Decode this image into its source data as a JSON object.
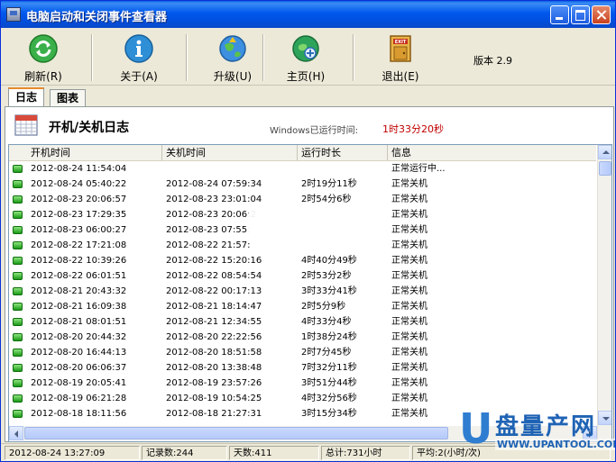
{
  "window": {
    "title": "电脑启动和关闭事件查看器"
  },
  "toolbar": {
    "refresh_label": "刷新(R)",
    "about_label": "关于(A)",
    "upgrade_label": "升级(U)",
    "home_label": "主页(H)",
    "exit_label": "退出(E)",
    "exit_badge": "EXIT",
    "version": "版本 2.9"
  },
  "tabs": [
    {
      "label": "日志",
      "active": true
    },
    {
      "label": "图表",
      "active": false
    }
  ],
  "panel": {
    "title": "开机/关机日志",
    "uptime_label": "Windows已运行时间:",
    "uptime_value": "1时33分20秒"
  },
  "columns": [
    "开机时间",
    "关机时间",
    "运行时长",
    "信息"
  ],
  "rows": [
    {
      "boot": "2012-08-24 11:54:04",
      "shutdown": "",
      "duration": "",
      "info": "正常运行中..."
    },
    {
      "boot": "2012-08-24 05:40:22",
      "shutdown": "2012-08-24 07:59:34",
      "duration": "2时19分11秒",
      "info": "正常关机"
    },
    {
      "boot": "2012-08-23 20:06:57",
      "shutdown": "2012-08-23 23:01:04",
      "duration": "2时54分6秒",
      "info": "正常关机"
    },
    {
      "boot": "2012-08-23 17:29:35",
      "shutdown": "2012-08-23 20:06:2",
      "duration": "",
      "info": "正常关机"
    },
    {
      "boot": "2012-08-23 06:00:27",
      "shutdown": "2012-08-23 07:55:",
      "duration": "",
      "info": "正常关机"
    },
    {
      "boot": "2012-08-22 17:21:08",
      "shutdown": "2012-08-22 21:57:",
      "duration": "",
      "info": "正常关机"
    },
    {
      "boot": "2012-08-22 10:39:26",
      "shutdown": "2012-08-22 15:20:16",
      "duration": "4时40分49秒",
      "info": "正常关机"
    },
    {
      "boot": "2012-08-22 06:01:51",
      "shutdown": "2012-08-22 08:54:54",
      "duration": "2时53分2秒",
      "info": "正常关机"
    },
    {
      "boot": "2012-08-21 20:43:32",
      "shutdown": "2012-08-22 00:17:13",
      "duration": "3时33分41秒",
      "info": "正常关机"
    },
    {
      "boot": "2012-08-21 16:09:38",
      "shutdown": "2012-08-21 18:14:47",
      "duration": "2时5分9秒",
      "info": "正常关机"
    },
    {
      "boot": "2012-08-21 08:01:51",
      "shutdown": "2012-08-21 12:34:55",
      "duration": "4时33分4秒",
      "info": "正常关机"
    },
    {
      "boot": "2012-08-20 20:44:32",
      "shutdown": "2012-08-20 22:22:56",
      "duration": "1时38分24秒",
      "info": "正常关机"
    },
    {
      "boot": "2012-08-20 16:44:13",
      "shutdown": "2012-08-20 18:51:58",
      "duration": "2时7分45秒",
      "info": "正常关机"
    },
    {
      "boot": "2012-08-20 06:06:37",
      "shutdown": "2012-08-20 13:38:48",
      "duration": "7时32分11秒",
      "info": "正常关机"
    },
    {
      "boot": "2012-08-19 20:05:41",
      "shutdown": "2012-08-19 23:57:26",
      "duration": "3时51分44秒",
      "info": "正常关机"
    },
    {
      "boot": "2012-08-19 06:21:28",
      "shutdown": "2012-08-19 10:54:25",
      "duration": "4时32分56秒",
      "info": "正常关机"
    },
    {
      "boot": "2012-08-18 18:11:56",
      "shutdown": "2012-08-18 21:27:31",
      "duration": "3时15分34秒",
      "info": "正常关机"
    }
  ],
  "statusbar": {
    "datetime": "2012-08-24 13:27:09",
    "records": "记录数:244",
    "days": "天数:411",
    "total": "总计:731小时",
    "average": "平均:2(小时/次)"
  },
  "watermark": {
    "brand": "盘量产网",
    "url": "WWW.UPANTOOL.COM"
  },
  "colors": {
    "title_bar": "#0058ee",
    "uptime_value": "#c00000",
    "status_led": "#1a9a17",
    "tab_accent": "#e68b2c"
  }
}
